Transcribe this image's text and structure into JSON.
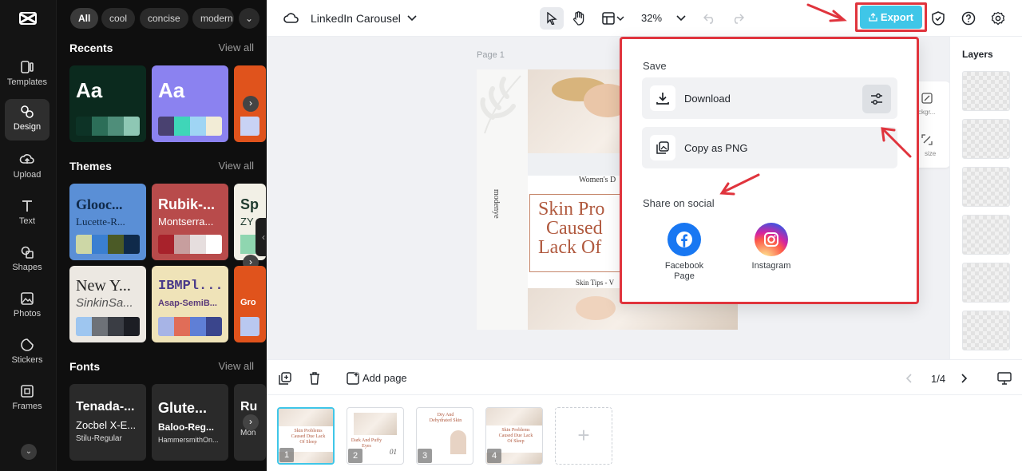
{
  "rail": {
    "items": [
      {
        "label": "Templates",
        "icon": "templates-icon"
      },
      {
        "label": "Design",
        "icon": "design-icon"
      },
      {
        "label": "Upload",
        "icon": "upload-icon"
      },
      {
        "label": "Text",
        "icon": "text-icon"
      },
      {
        "label": "Shapes",
        "icon": "shapes-icon"
      },
      {
        "label": "Photos",
        "icon": "photos-icon"
      },
      {
        "label": "Stickers",
        "icon": "stickers-icon"
      },
      {
        "label": "Frames",
        "icon": "frames-icon"
      }
    ],
    "active": "Design"
  },
  "panel": {
    "chips": [
      "All",
      "cool",
      "concise",
      "modern"
    ],
    "recents": {
      "title": "Recents",
      "view_all": "View all",
      "cards": [
        {
          "text": "Aa",
          "bg": "#0b2a1e",
          "swatches": [
            "#0d3326",
            "#2c6e58",
            "#4f8e7a",
            "#8ec7b4"
          ]
        },
        {
          "text": "Aa",
          "bg": "#8b82f0",
          "swatches": [
            "#494170",
            "#3fd6b8",
            "#9fd5f4",
            "#f2ecd6"
          ]
        }
      ]
    },
    "themes": {
      "title": "Themes",
      "view_all": "View all",
      "cards": [
        {
          "t1": "Glooc...",
          "t2": "Lucette-R...",
          "bg": "#5a8fd6",
          "color": "#102a4a",
          "swatches": [
            "#cdd7a6",
            "#3a7fd1",
            "#4b5a26",
            "#0f2a4a"
          ]
        },
        {
          "t1": "Rubik-...",
          "t2": "Montserra...",
          "bg": "#b84b4b",
          "color": "#ffffff",
          "swatches": [
            "#a8222b",
            "#c79e9e",
            "#e6dede",
            "#ffffff"
          ]
        },
        {
          "t1": "Sp",
          "t2": "ZY",
          "bg": "#f2f0e6",
          "color": "#1f3a2e",
          "swatches": [
            "#8fd6b0"
          ]
        },
        {
          "t1": "New Y...",
          "t2": "SinkinSa...",
          "bg": "#ece8e2",
          "color": "#222222",
          "swatches": [
            "#9ec6f0",
            "#6e7278",
            "#3a3d44",
            "#1c1e24"
          ]
        },
        {
          "t1": "IBMPl...",
          "t2": "Asap-SemiB...",
          "bg": "#efe3b8",
          "color": "#4a3a8a",
          "swatches": [
            "#a7b4e6",
            "#e06d58",
            "#5f7fd6",
            "#3a458c"
          ]
        },
        {
          "t1": "Gro",
          "t2": "",
          "bg": "#e0531c",
          "color": "#ffffff",
          "swatches": [
            "#b9c8f0"
          ]
        }
      ]
    },
    "fonts": {
      "title": "Fonts",
      "view_all": "View all",
      "cards": [
        {
          "l1": "Tenada-...",
          "l2": "Zocbel X-E...",
          "l3": "Stilu-Regular"
        },
        {
          "l1": "Glute...",
          "l2": "Baloo-Reg...",
          "l3": "HammersmithOn..."
        },
        {
          "l1": "Ru",
          "l2": "",
          "l3": "Mon"
        }
      ]
    }
  },
  "topbar": {
    "doc_title": "LinkedIn Carousel",
    "zoom": "32%",
    "export_label": "Export"
  },
  "canvas": {
    "page_label": "Page 1",
    "brand_vertical": "modenye",
    "women_day": "Women's D",
    "headline": [
      "Skin Pro",
      "Caused",
      "Lack Of"
    ],
    "skin_tips": "Skin Tips - V"
  },
  "util_card": {
    "label1": "ckgr...",
    "label2": "size"
  },
  "layers": {
    "title": "Layers"
  },
  "bottom": {
    "add_page": "Add page",
    "page_count": "1/4"
  },
  "thumbnails": [
    {
      "num": "1",
      "text": "Skin Problems Caused Due Lack Of Sleep"
    },
    {
      "num": "2",
      "text": "Dark And Puffy Eyes"
    },
    {
      "num": "3",
      "text": "Dry And Dehydrated Skin"
    },
    {
      "num": "4",
      "text": "Skin Problems Caused Due Lack Of Sleep"
    }
  ],
  "export_popover": {
    "save_heading": "Save",
    "download_label": "Download",
    "copy_label": "Copy as PNG",
    "share_heading": "Share on social",
    "social": [
      {
        "name": "Facebook Page",
        "line1": "Facebook",
        "line2": "Page",
        "color": "#1877f2"
      },
      {
        "name": "Instagram",
        "line1": "Instagram",
        "line2": "",
        "color": "#d6249f"
      }
    ]
  },
  "colors": {
    "accent": "#3fc6e8",
    "annotation_red": "#e0343d",
    "rail_bg": "#141414",
    "panel_bg": "#0f0f0f"
  }
}
